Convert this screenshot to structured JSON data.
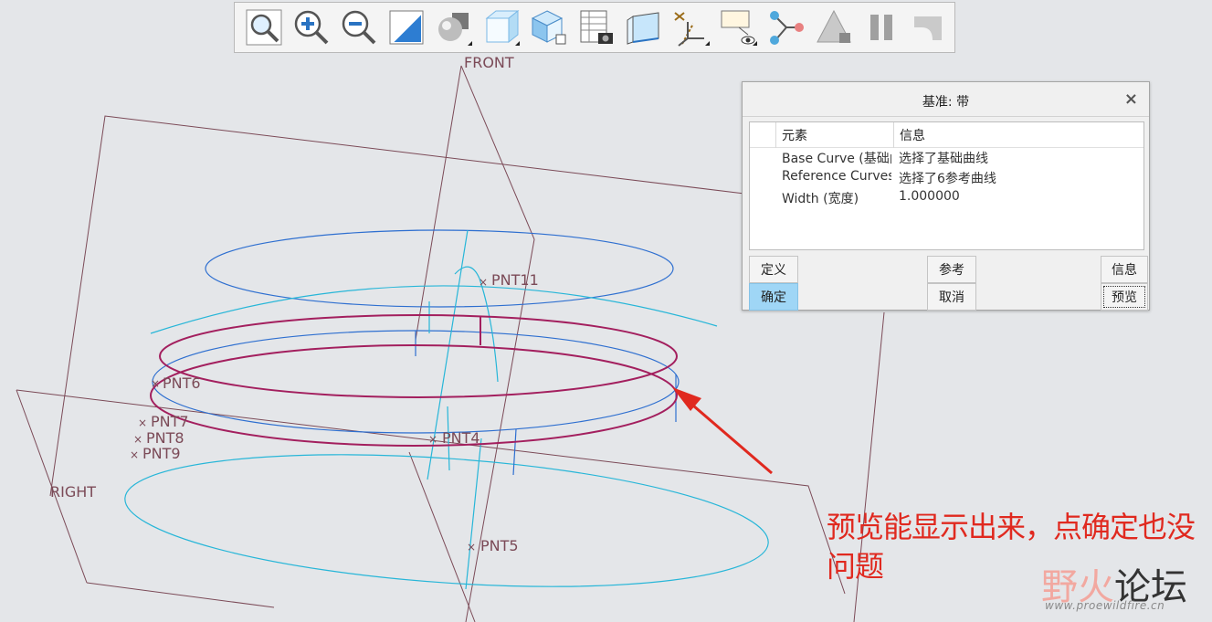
{
  "toolbar": {
    "buttons": [
      {
        "name": "zoom-fit-icon"
      },
      {
        "name": "zoom-in-icon"
      },
      {
        "name": "zoom-out-icon"
      },
      {
        "name": "repaint-icon"
      },
      {
        "name": "render-style-icon"
      },
      {
        "name": "shaded-box-icon"
      },
      {
        "name": "saved-orientation-icon"
      },
      {
        "name": "view-manager-icon"
      },
      {
        "name": "wireframe-box-icon"
      },
      {
        "name": "datum-display-icon"
      },
      {
        "name": "annotation-display-icon"
      },
      {
        "name": "spin-center-icon"
      },
      {
        "name": "model-lock-icon"
      },
      {
        "name": "pause-icon"
      },
      {
        "name": "regenerate-icon"
      }
    ]
  },
  "viewport": {
    "plane_labels": {
      "front": "FRONT",
      "right": "RIGHT"
    },
    "points": {
      "pnt11": "PNT11",
      "pnt6": "PNT6",
      "pnt7": "PNT7",
      "pnt8": "PNT8",
      "pnt9": "PNT9",
      "pnt4": "PNT4",
      "pnt5": "PNT5"
    },
    "colors": {
      "datum_plane": "#7b4a57",
      "blue_curve": "#2e6fd0",
      "cyan_curve": "#27b6d8",
      "band_curve": "#a31f5e",
      "arrow": "#e0291f"
    }
  },
  "dialog": {
    "title": "基准: 带",
    "close": "×",
    "table": {
      "headers": [
        "元素",
        "信息"
      ],
      "rows": [
        {
          "element": "Base Curve (基础曲线)",
          "info": "选择了基础曲线"
        },
        {
          "element": "Reference Curves",
          "info": "选择了6参考曲线"
        },
        {
          "element": "Width (宽度)",
          "info": "1.000000"
        }
      ]
    },
    "buttons": {
      "define": "定义",
      "ok": "确定",
      "refs": "参考",
      "cancel": "取消",
      "info": "信息",
      "preview": "预览"
    }
  },
  "annotation": {
    "text": "预览能显示出来，点确定也没问题"
  },
  "watermark": {
    "ye": "野火",
    "forum": "论坛",
    "url": "www.proewildfire.cn"
  }
}
